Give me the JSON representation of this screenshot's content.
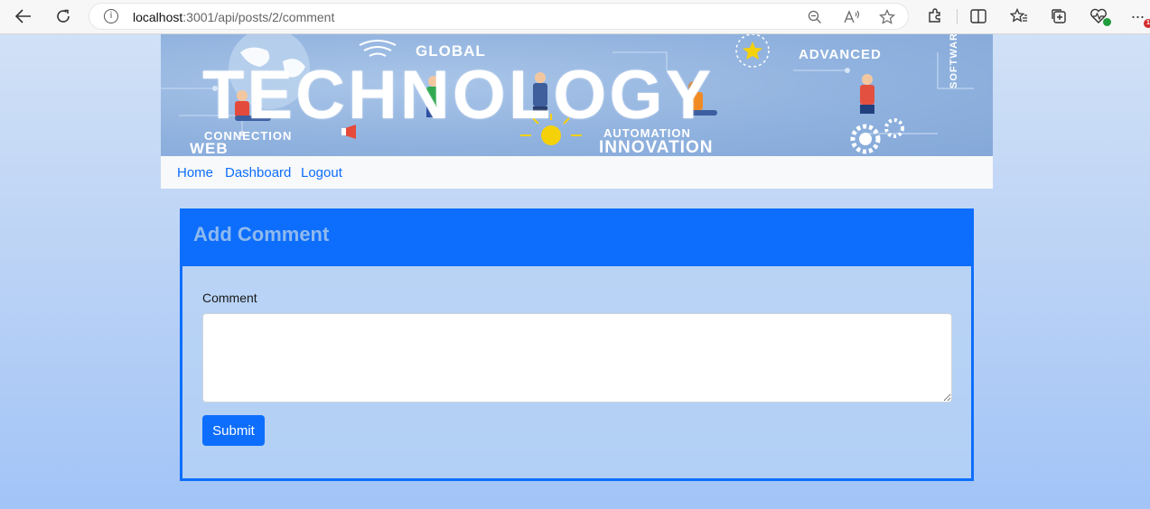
{
  "browser": {
    "url_host": "localhost",
    "url_rest": ":3001/api/posts/2/comment",
    "icons": [
      "back-icon",
      "refresh-icon",
      "site-info-icon",
      "zoom-icon",
      "read-aloud-icon",
      "favorite-star-icon",
      "extensions-icon",
      "split-screen-icon",
      "favorites-icon",
      "collections-icon",
      "browser-essentials-icon",
      "more-icon"
    ],
    "notification_badge": "1"
  },
  "banner": {
    "title": "TECHNOLOGY",
    "words": {
      "global": "GLOBAL",
      "advanced": "ADVANCED",
      "connection": "CONNECTION",
      "web": "WEB",
      "automation": "AUTOMATION",
      "innovation": "INNOVATION",
      "software": "SOFTWARE"
    },
    "colors": {
      "bg": "#8fb1de",
      "text": "#ffffff",
      "accent": "#f5d10a"
    }
  },
  "nav": {
    "items": [
      {
        "label": "Home"
      },
      {
        "label": "Dashboard"
      },
      {
        "label": "Logout"
      }
    ],
    "link_color": "#0d6efd"
  },
  "form": {
    "title": "Add Comment",
    "comment_label": "Comment",
    "comment_value": "",
    "comment_placeholder": "",
    "submit_label": "Submit",
    "accent": "#0d6efd"
  }
}
